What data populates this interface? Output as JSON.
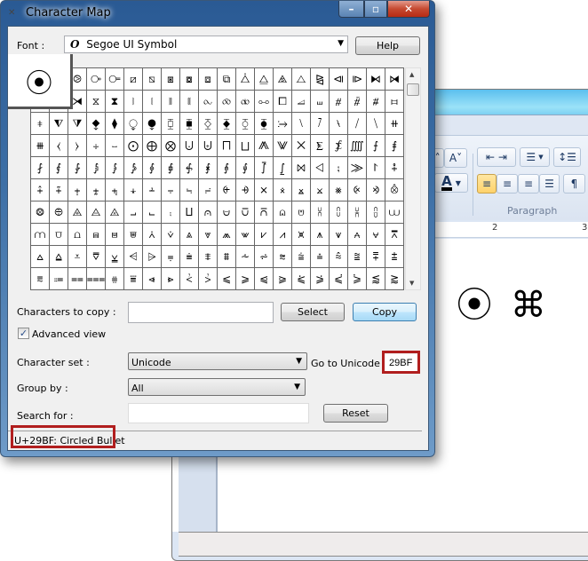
{
  "word": {
    "ribbon": {
      "group_label": "Paragraph",
      "font_buttons": [
        "A˄",
        "A˅",
        "A"
      ],
      "paragraph_buttons": [
        "decrease-indent",
        "increase-indent",
        "bullets",
        "line-spacing",
        "align-left",
        "align-center",
        "align-right",
        "justify",
        "text-direction"
      ],
      "active_button": "align-left"
    },
    "ruler": {
      "marks": [
        "2",
        "3"
      ]
    },
    "document_text": "⦿ ⌘"
  },
  "charmap": {
    "title": "Character Map",
    "font_label": "Font :",
    "font_value": "Segoe UI Symbol",
    "font_icon_glyph": "O",
    "help_label": "Help",
    "enlarged_char": "⦿",
    "grid_rows": [
      "⦿⧀⧁⧂⧃⧄⧅⧆⧇⧈⧉⧊⧋⧌⧍⧎⧏⧐⧑⧒",
      "⧓⧔⧕⧖⧗⧘⧙⧚⧛⧜⧝⧞⧟⧠⧡⧢⧣⧤⧥⧦",
      "⧧⧨⧩⧪⧫⧬⧭⧮⧯⧰⧱⧲⧳⧴⧵⧶⧷⧸⧹⧺",
      "⧻⧼⧽⧾⧿⨀⨁⨂⨃⨄⨅⨆⨇⨈⨉⨊⨋⨌⨍⨎",
      "⨏⨐⨑⨒⨓⨔⨕⨖⨗⨘⨙⨚⨛⨜⨝⨞⨟⨠⨡⨢",
      "⨣⨤⨥⨦⨧⨨⨩⨪⨫⨬⨭⨮⨯⨰⨱⨲⨳⨴⨵⨶",
      "⨷⨸⨹⨺⨻⨼⨽⨾⨿⩀⩁⩂⩃⩄⩅⩆⩇⩈⩉⩊",
      "⩋⩌⩍⩎⩏⩐⩑⩒⩓⩔⩕⩖⩗⩘⩙⩚⩛⩜⩝⩞",
      "⩟⩠⩡⩢⩣⩤⩥⩦⩧⩨⩩⩪⩫⩬⩭⩮⩯⩰⩱⩲",
      "⩳⩴⩵⩶⩷⩸⩹⩺⩻⩼⩽⩾⩿⪀⪁⪂⪃⪄⪅⪆"
    ],
    "chars_to_copy_label": "Characters to copy :",
    "chars_to_copy_value": "",
    "select_label": "Select",
    "copy_label": "Copy",
    "advanced_view_label": "Advanced view",
    "advanced_view_checked": true,
    "charset_label": "Character set :",
    "charset_value": "Unicode",
    "goto_unicode_label": "Go to Unicode :",
    "goto_unicode_value": "29BF",
    "group_by_label": "Group by :",
    "group_by_value": "All",
    "search_label": "Search for :",
    "search_value": "",
    "reset_label": "Reset",
    "status_text": "U+29BF: Circled Bullet",
    "highlight_color": "#b11e1e"
  }
}
